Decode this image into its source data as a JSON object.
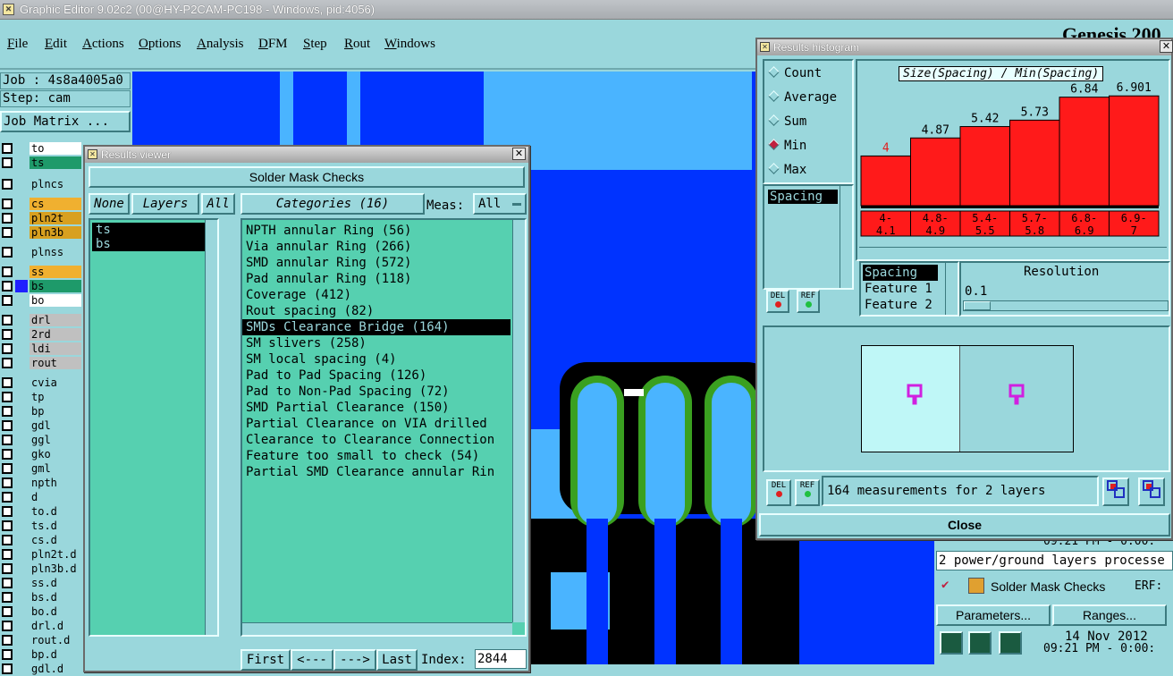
{
  "app": {
    "title": "Graphic Editor 9.02c2 (00@HY-P2CAM-PC198 - Windows, pid:4056)",
    "brand": "Genesis 200"
  },
  "menu": [
    "File",
    "Edit",
    "Actions",
    "Options",
    "Analysis",
    "DFM",
    "Step",
    "Rout",
    "Windows"
  ],
  "job": {
    "job_label": "Job : 4s8a4005a0",
    "step_label": "Step: cam",
    "matrix_button": "Job Matrix ..."
  },
  "layers": [
    {
      "name": "to",
      "color": "#ffffff",
      "swatch": "#9ad7dc"
    },
    {
      "name": "ts",
      "color": "#1e9a6a",
      "swatch": "#9ad7dc"
    },
    {
      "name": "plncs",
      "color": "#9ad7dc",
      "swatch": "#9ad7dc"
    },
    {
      "name": "cs",
      "color": "#f0b030",
      "swatch": "#9ad7dc"
    },
    {
      "name": "pln2t",
      "color": "#d8a020",
      "swatch": "#9ad7dc"
    },
    {
      "name": "pln3b",
      "color": "#d8a020",
      "swatch": "#9ad7dc"
    },
    {
      "name": "plnss",
      "color": "#9ad7dc",
      "swatch": "#9ad7dc"
    },
    {
      "name": "ss",
      "color": "#f0b030",
      "swatch": "#9ad7dc"
    },
    {
      "name": "bs",
      "color": "#1e9a6a",
      "swatch": "#2020ff"
    },
    {
      "name": "bo",
      "color": "#ffffff",
      "swatch": "#9ad7dc"
    },
    {
      "name": "drl",
      "color": "#c0c0c0",
      "swatch": "#9ad7dc"
    },
    {
      "name": "2rd",
      "color": "#c0c0c0",
      "swatch": "#9ad7dc"
    },
    {
      "name": "ldi",
      "color": "#c0c0c0",
      "swatch": "#9ad7dc"
    },
    {
      "name": "rout",
      "color": "#c0c0c0",
      "swatch": "#9ad7dc"
    },
    {
      "name": "cvia",
      "color": "#9ad7dc",
      "swatch": "#9ad7dc"
    },
    {
      "name": "tp",
      "color": "#9ad7dc",
      "swatch": "#9ad7dc"
    },
    {
      "name": "bp",
      "color": "#9ad7dc",
      "swatch": "#9ad7dc"
    },
    {
      "name": "gdl",
      "color": "#9ad7dc",
      "swatch": "#9ad7dc"
    },
    {
      "name": "ggl",
      "color": "#9ad7dc",
      "swatch": "#9ad7dc"
    },
    {
      "name": "gko",
      "color": "#9ad7dc",
      "swatch": "#9ad7dc"
    },
    {
      "name": "gml",
      "color": "#9ad7dc",
      "swatch": "#9ad7dc"
    },
    {
      "name": "npth",
      "color": "#9ad7dc",
      "swatch": "#9ad7dc"
    },
    {
      "name": "d",
      "color": "#9ad7dc",
      "swatch": "#9ad7dc"
    },
    {
      "name": "to.d",
      "color": "#9ad7dc",
      "swatch": "#9ad7dc"
    },
    {
      "name": "ts.d",
      "color": "#9ad7dc",
      "swatch": "#9ad7dc"
    },
    {
      "name": "cs.d",
      "color": "#9ad7dc",
      "swatch": "#9ad7dc"
    },
    {
      "name": "pln2t.d",
      "color": "#9ad7dc",
      "swatch": "#9ad7dc"
    },
    {
      "name": "pln3b.d",
      "color": "#9ad7dc",
      "swatch": "#9ad7dc"
    },
    {
      "name": "ss.d",
      "color": "#9ad7dc",
      "swatch": "#9ad7dc"
    },
    {
      "name": "bs.d",
      "color": "#9ad7dc",
      "swatch": "#9ad7dc"
    },
    {
      "name": "bo.d",
      "color": "#9ad7dc",
      "swatch": "#9ad7dc"
    },
    {
      "name": "drl.d",
      "color": "#9ad7dc",
      "swatch": "#9ad7dc"
    },
    {
      "name": "rout.d",
      "color": "#9ad7dc",
      "swatch": "#9ad7dc"
    },
    {
      "name": "bp.d",
      "color": "#9ad7dc",
      "swatch": "#9ad7dc"
    },
    {
      "name": "gdl.d",
      "color": "#9ad7dc",
      "swatch": "#9ad7dc"
    }
  ],
  "results_viewer": {
    "title": "Results viewer",
    "header": "Solder Mask Checks",
    "none_btn": "None",
    "layers_btn": "Layers",
    "all_btn": "All",
    "categories_btn": "Categories (16)",
    "meas_label": "Meas:",
    "meas_value": "All",
    "layer_items": [
      "ts",
      "bs"
    ],
    "categories": [
      "NPTH annular Ring (56)",
      "Via annular Ring (266)",
      "SMD annular Ring (572)",
      "Pad annular Ring (118)",
      "Coverage (412)",
      "Rout spacing (82)",
      "SMDs Clearance Bridge (164)",
      "SM slivers (258)",
      "SM local spacing (4)",
      "Pad to Pad Spacing (126)",
      "Pad to Non-Pad Spacing (72)",
      "SMD Partial Clearance (150)",
      "Partial Clearance on VIA drilled",
      "Clearance to Clearance Connection",
      "Feature too small to check (54)",
      "Partial SMD Clearance annular Rin"
    ],
    "selected_category": 6,
    "nav": {
      "first": "First",
      "prev": "<---",
      "next": "--->",
      "last": "Last",
      "index_label": "Index:",
      "index_value": "2844"
    }
  },
  "histogram": {
    "title": "Results histogram",
    "modes": [
      "Count",
      "Average",
      "Sum",
      "Min",
      "Max"
    ],
    "selected_mode": "Min",
    "measure_list": [
      "Spacing"
    ],
    "chart_title": "Size(Spacing) / Min(Spacing)",
    "fields": [
      "Spacing",
      "Feature 1",
      "Feature 2"
    ],
    "resolution_label": "Resolution",
    "resolution_value": "0.1",
    "status": "164 measurements for 2 layers",
    "close": "Close",
    "del": "DEL",
    "ref": "REF"
  },
  "chart_data": {
    "type": "bar",
    "title": "Size(Spacing) / Min(Spacing)",
    "categories": [
      "4-4.1",
      "4.8-4.9",
      "5.4-5.5",
      "5.7-5.8",
      "6.8-6.9",
      "6.9-7"
    ],
    "category_lines": [
      [
        "4-",
        "4.1"
      ],
      [
        "4.8-",
        "4.9"
      ],
      [
        "5.4-",
        "5.5"
      ],
      [
        "5.7-",
        "5.8"
      ],
      [
        "6.8-",
        "6.9"
      ],
      [
        "6.9-",
        "7"
      ]
    ],
    "values": [
      4,
      4.87,
      5.42,
      5.73,
      6.84,
      6.901
    ],
    "value_labels": [
      "4",
      "4.87",
      "5.42",
      "5.73",
      "6.84",
      "6.901"
    ],
    "ylim": [
      1.6,
      7.3
    ],
    "bar_color": "#ff1a1a",
    "grid": false
  },
  "erf_panel": {
    "time1": "09:21 PM - 0:00:",
    "log": "2 power/ground layers processe",
    "check_name": "Solder Mask Checks",
    "erf_label": "ERF:",
    "params_btn": "Parameters...",
    "ranges_btn": "Ranges...",
    "date": "14 Nov 2012",
    "time2": "09:21 PM - 0:00:"
  },
  "colors": {
    "bg": "#9ad7dc",
    "panel": "#56d0b0",
    "canvas": "#0033ff",
    "pad_green": "#3aa020",
    "light_blue": "#4ab4ff"
  }
}
